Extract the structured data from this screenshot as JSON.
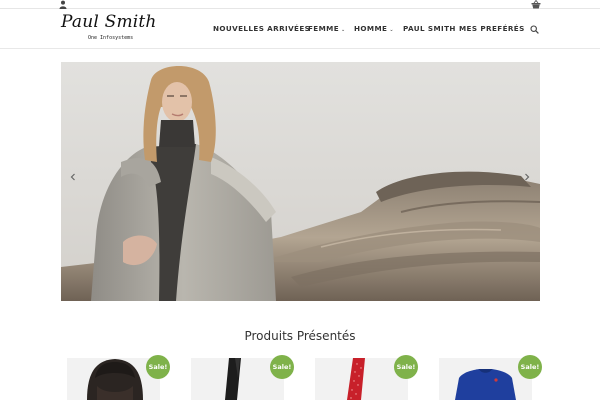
{
  "header": {
    "logo_script": "Paul Smith",
    "logo_tagline": "One Infosystems",
    "nav": [
      {
        "label": "NOUVELLES ARRIVÉES",
        "has_dropdown": false
      },
      {
        "label": "FEMME",
        "has_dropdown": true
      },
      {
        "label": "HOMME",
        "has_dropdown": true
      },
      {
        "label": "PAUL SMITH",
        "has_dropdown": false
      },
      {
        "label": "MES PREFÉRÉS",
        "has_dropdown": false
      }
    ],
    "dropdown_glyph": "⌄"
  },
  "icons": {
    "account": "user-icon",
    "cart": "basket-icon",
    "search": "search-icon",
    "prev": "chevron-left-icon",
    "next": "chevron-right-icon"
  },
  "featured": {
    "title": "Produits Présentés",
    "products": [
      {
        "badge": "Sale!"
      },
      {
        "badge": "Sale!"
      },
      {
        "badge": "Sale!"
      },
      {
        "badge": "Sale!"
      }
    ]
  },
  "colors": {
    "sale_badge": "#7fb24a",
    "text": "#333333"
  }
}
